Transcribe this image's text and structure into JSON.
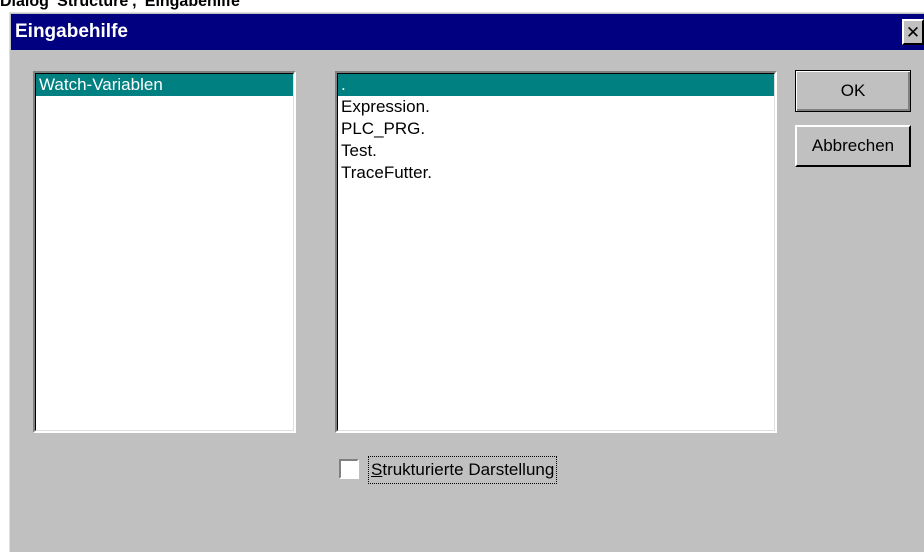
{
  "page_caption": "Dialog 'Structure', 'Eingabehilfe'",
  "dialog": {
    "title": "Eingabehilfe",
    "close_glyph": "✕"
  },
  "categories": {
    "items": [
      {
        "label": "Watch-Variablen",
        "selected": true
      }
    ]
  },
  "entries": {
    "items": [
      {
        "label": ".",
        "selected": true
      },
      {
        "label": "Expression.",
        "selected": false
      },
      {
        "label": "PLC_PRG.",
        "selected": false
      },
      {
        "label": "Test.",
        "selected": false
      },
      {
        "label": "TraceFutter.",
        "selected": false
      }
    ]
  },
  "buttons": {
    "ok_label": "OK",
    "cancel_label": "Abbrechen"
  },
  "structured_view": {
    "mnemonic": "S",
    "label_rest": "trukturierte Darstellung",
    "checked": false
  },
  "colors": {
    "titlebar": "#000080",
    "selection": "#008080",
    "dialog_face": "#c0c0c0"
  }
}
